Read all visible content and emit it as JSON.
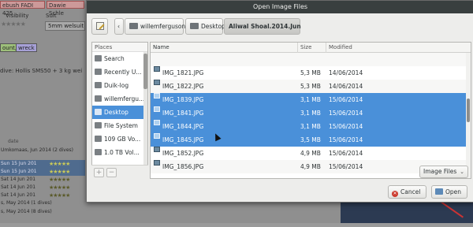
{
  "background": {
    "tags": [
      "ebush FADI 425",
      "Dawie Schle"
    ],
    "visibility_label": "Visibility",
    "suit_label": "Suit",
    "suit_value": "5mm welsuit",
    "chips": [
      "ount,",
      "wreck"
    ],
    "gear_text": "dive: Hollis SMS50 + 3 kg wei",
    "list_header": "date",
    "dive_rows": [
      {
        "text": "Umkomaas, Jun 2014 (2 dives)",
        "stars": "",
        "selected": false
      },
      {
        "text": "Sun 15 Jun 201",
        "stars": "★★★★★",
        "selected": true
      },
      {
        "text": "Sun 15 Jun 201",
        "stars": "★★★★★",
        "selected": true
      },
      {
        "text": "Sat 14 Jun 201",
        "stars": "★★★★★",
        "selected": false
      },
      {
        "text": "Sat 14 Jun 201",
        "stars": "★★★★★",
        "selected": false
      },
      {
        "text": "Sat 14 Jun 201",
        "stars": "★★★★★",
        "selected": false
      },
      {
        "text": "s, May 2014 (1 dives)",
        "stars": "",
        "selected": false
      },
      {
        "text": "s, May 2014 (8 dives)",
        "stars": "",
        "selected": false
      }
    ]
  },
  "dialog": {
    "title": "Open Image Files",
    "path": {
      "edit_icon": "pencil-icon",
      "back_arrow": "‹",
      "crumbs": [
        "willemferguson",
        "Desktop",
        "Aliwal Shoal.2014.Jun"
      ]
    },
    "places": {
      "header": "Places",
      "items": [
        {
          "label": "Search",
          "icon": "search-icon"
        },
        {
          "label": "Recently U...",
          "icon": "recent-icon"
        },
        {
          "label": "Duik-log",
          "icon": "folder-icon"
        },
        {
          "label": "willemfergu...",
          "icon": "home-icon"
        },
        {
          "label": "Desktop",
          "icon": "desktop-icon",
          "selected": true
        },
        {
          "label": "File System",
          "icon": "drive-icon"
        },
        {
          "label": "109 GB Vo...",
          "icon": "drive-icon"
        },
        {
          "label": "1.0 TB Vol...",
          "icon": "drive-icon"
        }
      ],
      "add_label": "+",
      "remove_label": "−"
    },
    "columns": {
      "name": "Name",
      "size": "Size",
      "modified": "Modified"
    },
    "files": [
      {
        "name": "",
        "size": "",
        "modified": "",
        "selected": false
      },
      {
        "name": "IMG_1821.JPG",
        "size": "5,3 MB",
        "modified": "14/06/2014",
        "selected": false
      },
      {
        "name": "IMG_1822.JPG",
        "size": "5,3 MB",
        "modified": "14/06/2014",
        "selected": false
      },
      {
        "name": "IMG_1839.JPG",
        "size": "3,1 MB",
        "modified": "15/06/2014",
        "selected": true
      },
      {
        "name": "IMG_1841.JPG",
        "size": "3,1 MB",
        "modified": "15/06/2014",
        "selected": true
      },
      {
        "name": "IMG_1844.JPG",
        "size": "3,1 MB",
        "modified": "15/06/2014",
        "selected": true
      },
      {
        "name": "IMG_1845.JPG",
        "size": "3,5 MB",
        "modified": "15/06/2014",
        "selected": true
      },
      {
        "name": "IMG_1852.JPG",
        "size": "4,9 MB",
        "modified": "15/06/2014",
        "selected": false
      },
      {
        "name": "IMG_1856.JPG",
        "size": "4,9 MB",
        "modified": "15/06/2014",
        "selected": false
      }
    ],
    "filter": {
      "value": "Image Files",
      "arrow": "⌄"
    },
    "buttons": {
      "cancel": "Cancel",
      "open": "Open",
      "cancel_glyph": "✕"
    }
  }
}
